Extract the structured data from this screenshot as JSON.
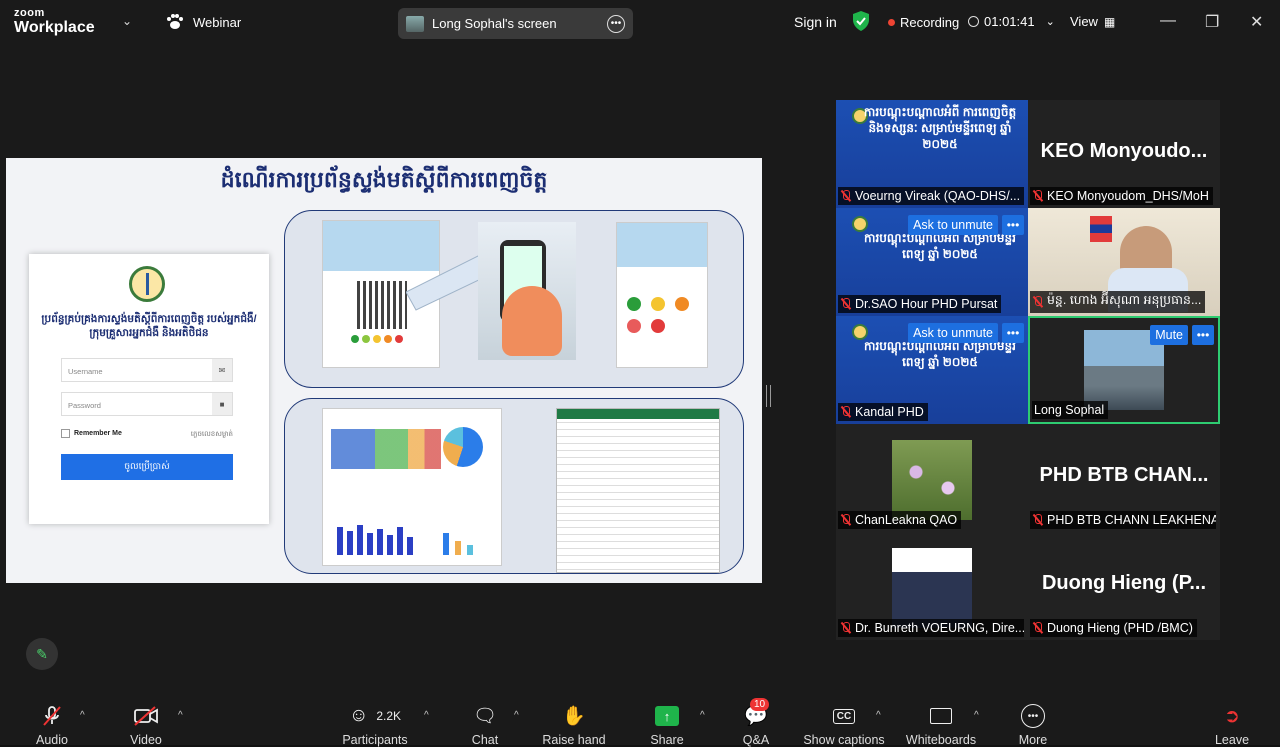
{
  "app": {
    "brand_top": "zoom",
    "brand_bottom": "Workplace",
    "webinar_label": "Webinar"
  },
  "screen_share": {
    "label": "Long Sophal's screen"
  },
  "header": {
    "sign_in": "Sign in",
    "recording": "Recording",
    "timer": "01:01:41",
    "view": "View"
  },
  "slide": {
    "title": "ដំណើរការប្រព័ន្ធស្ទង់មតិស្តីពីការពេញចិត្ត",
    "login_title": "ប្រព័ន្ធគ្រប់គ្រងការស្ទង់មតិស្តីពីការពេញចិត្ត របស់អ្នកជំងឺ/ក្រុមគ្រួសារអ្នកជំងឺ និងអតិថិជន",
    "username_placeholder": "Username",
    "password_placeholder": "Password",
    "remember_me": "Remember Me",
    "forgot": "ភ្លេចលេខសម្ងាត់",
    "login_button": "ចូលប្រើប្រាស់"
  },
  "participants": [
    {
      "name": "Voeurng Vireak (QAO-DHS/...",
      "banner": "ការបណ្តុះបណ្តាលអំពី ការពេញចិត្ត និងទស្សនៈ សម្រាប់មន្ទីរពេទ្យ ឆ្នាំ ២០២៥"
    },
    {
      "name": "KEO Monyoudom_DHS/MoH",
      "display": "KEO Monyoudo..."
    },
    {
      "name": "Dr.SAO Hour PHD Pursat",
      "banner": "ការបណ្តុះបណ្តាលអំពី សម្រាប់មន្ទីរពេទ្យ ឆ្នាំ ២០២៥",
      "hover": "Ask to unmute"
    },
    {
      "name": "ម៉ន្ត. ហោង អ៊ីសុណា អនុប្រធាន..."
    },
    {
      "name": "Kandal PHD",
      "banner": "ការបណ្តុះបណ្តាលអំពី សម្រាប់មន្ទីរពេទ្យ ឆ្នាំ ២០២៥",
      "hover": "Ask to unmute"
    },
    {
      "name": "Long Sophal",
      "hover": "Mute"
    },
    {
      "name": "ChanLeakna QAO"
    },
    {
      "name": "PHD BTB CHANN LEAKHENA",
      "display": "PHD BTB CHAN..."
    },
    {
      "name": "Dr. Bunreth VOEURNG, Dire..."
    },
    {
      "name": "Duong Hieng (PHD /BMC)",
      "display": "Duong Hieng (P..."
    }
  ],
  "toolbar": {
    "audio": "Audio",
    "video": "Video",
    "participants": "Participants",
    "participant_count": "2.2K",
    "chat": "Chat",
    "raise_hand": "Raise hand",
    "share": "Share",
    "qa": "Q&A",
    "qa_badge": "10",
    "captions": "Show captions",
    "whiteboards": "Whiteboards",
    "more": "More",
    "leave": "Leave"
  },
  "colors": {
    "accent": "#1d6fe0",
    "share": "#1fb44b",
    "record": "#e43",
    "active": "#2ecc71"
  }
}
